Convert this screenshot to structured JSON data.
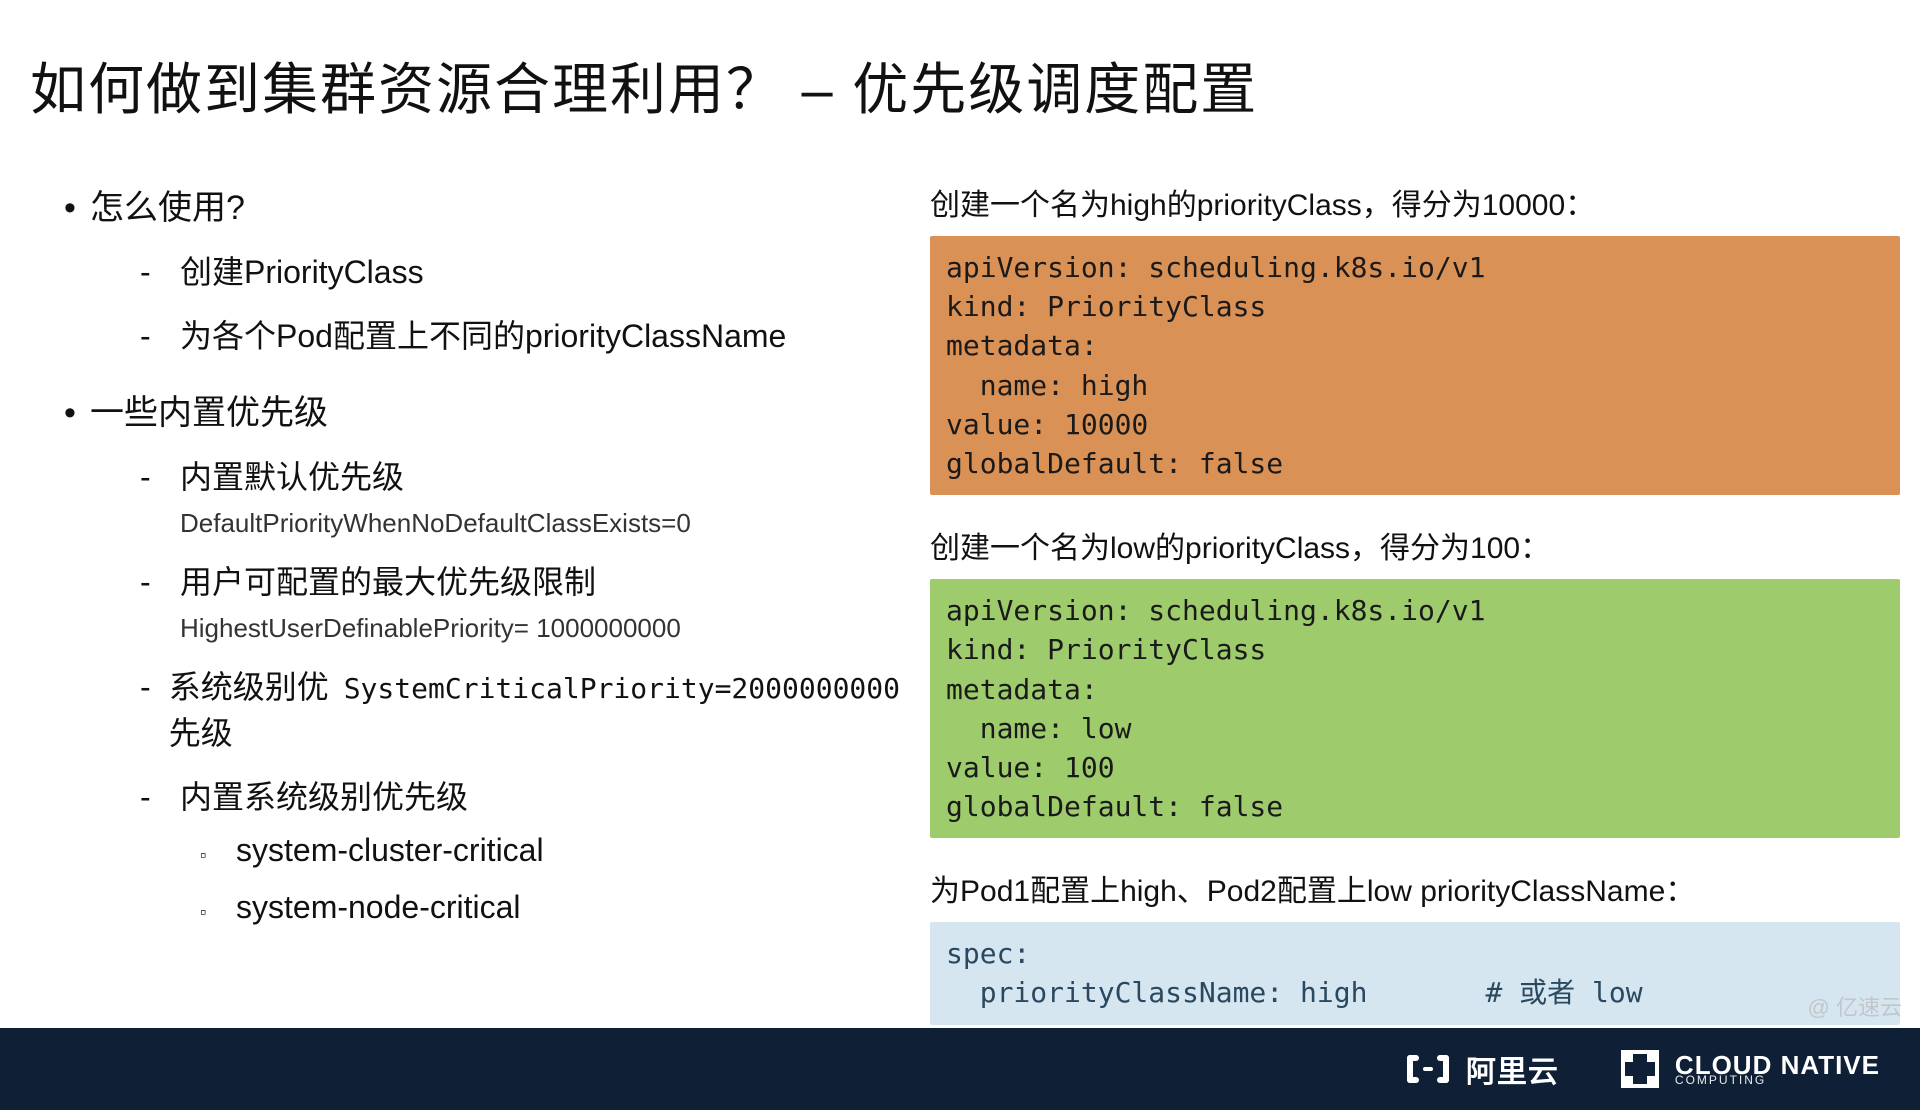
{
  "title": "如何做到集群资源合理利用？ – 优先级调度配置",
  "left": {
    "items": [
      {
        "label": "怎么使用?",
        "sub": [
          {
            "label": "创建PriorityClass"
          },
          {
            "label": "为各个Pod配置上不同的priorityClassName"
          }
        ]
      },
      {
        "label": "一些内置优先级",
        "sub": [
          {
            "label": "内置默认优先级",
            "detail": "DefaultPriorityWhenNoDefaultClassExists=0"
          },
          {
            "label": "用户可配置的最大优先级限制",
            "detail": "HighestUserDefinablePriority= 1000000000"
          },
          {
            "label": "系统级别优先级",
            "inline": "SystemCriticalPriority=2000000000"
          },
          {
            "label": "内置系统级别优先级",
            "sub2": [
              "system-cluster-critical",
              "system-node-critical"
            ]
          }
        ]
      }
    ]
  },
  "right": {
    "sec1_caption": "创建一个名为high的priorityClass，得分为10000：",
    "sec1_code": "apiVersion: scheduling.k8s.io/v1\nkind: PriorityClass\nmetadata:\n  name: high\nvalue: 10000\nglobalDefault: false",
    "sec2_caption": "创建一个名为low的priorityClass，得分为100：",
    "sec2_code": "apiVersion: scheduling.k8s.io/v1\nkind: PriorityClass\nmetadata:\n  name: low\nvalue: 100\nglobalDefault: false",
    "sec3_caption": "为Pod1配置上high、Pod2配置上low priorityClassName：",
    "sec3_code": "spec:\n  priorityClassName: high       # 或者 low"
  },
  "footer": {
    "aliyun": "阿里云",
    "cncf_top": "CLOUD NATIVE",
    "cncf_bottom": "COMPUTING"
  },
  "watermark": "@ 亿速云"
}
